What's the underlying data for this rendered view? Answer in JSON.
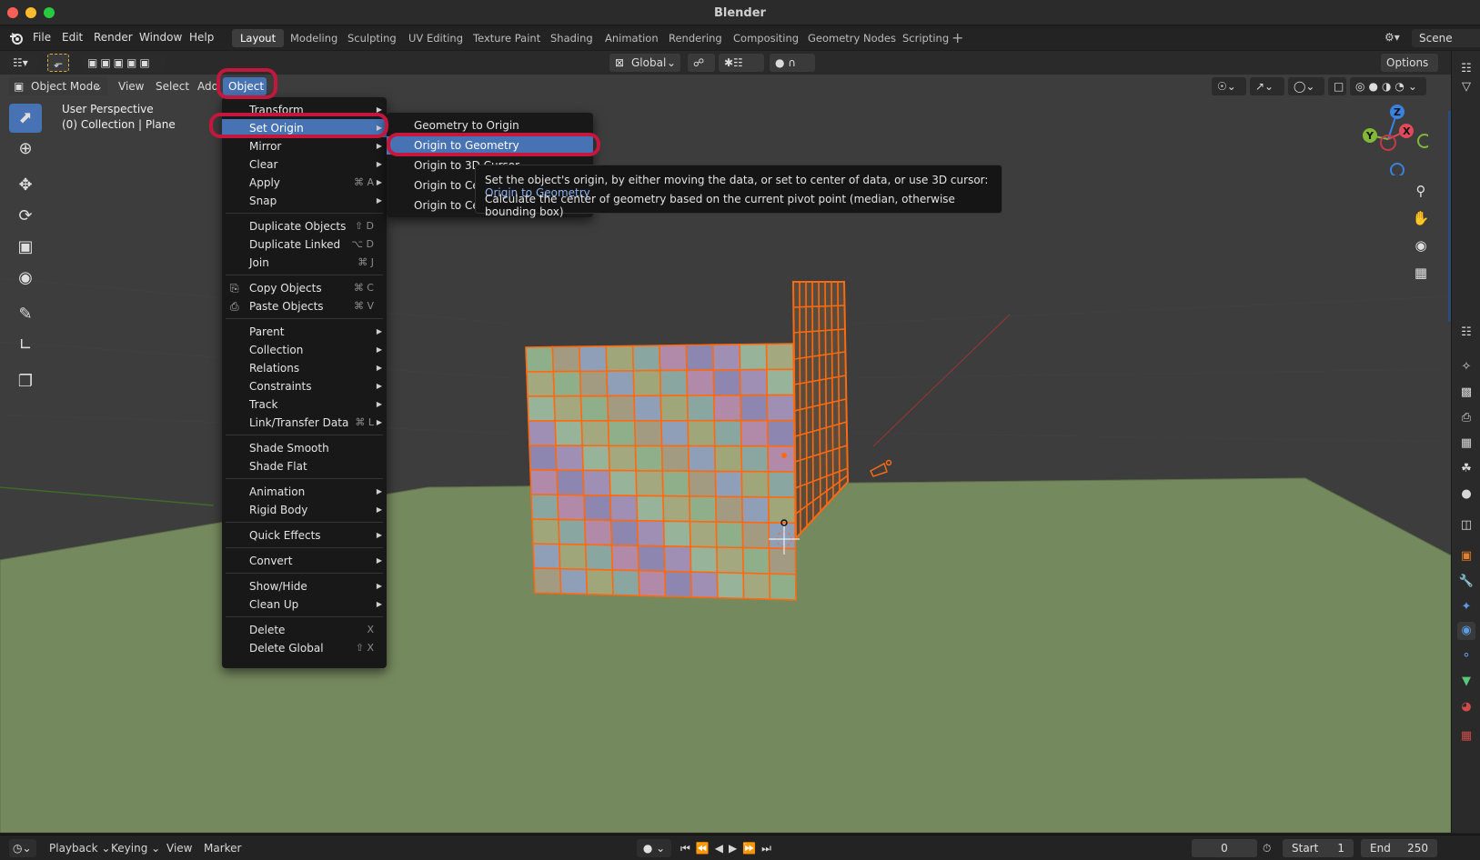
{
  "window": {
    "title": "Blender"
  },
  "menubar": {
    "items": [
      "File",
      "Edit",
      "Render",
      "Window",
      "Help"
    ],
    "workspaces": [
      "Layout",
      "Modeling",
      "Sculpting",
      "UV Editing",
      "Texture Paint",
      "Shading",
      "Animation",
      "Rendering",
      "Compositing",
      "Geometry Nodes",
      "Scripting"
    ],
    "active_workspace": "Layout",
    "scene": "Scene"
  },
  "header": {
    "transform_orientation": "Global",
    "options_label": "Options",
    "mode": "Object Mode",
    "menus": [
      "View",
      "Select",
      "Add",
      "Object"
    ]
  },
  "viewport": {
    "perspective_label": "User Perspective",
    "collection_label": "(0) Collection | Plane",
    "gizmo": {
      "z": "Z",
      "y": "Y",
      "x": "X"
    }
  },
  "object_menu": {
    "items": [
      {
        "label": "Transform",
        "shortcut": "",
        "submenu": true
      },
      {
        "label": "Set Origin",
        "shortcut": "",
        "submenu": true,
        "highlighted": true
      },
      {
        "label": "Mirror",
        "shortcut": "",
        "submenu": true
      },
      {
        "label": "Clear",
        "shortcut": "",
        "submenu": true
      },
      {
        "label": "Apply",
        "shortcut": "⌘ A",
        "submenu": true
      },
      {
        "label": "Snap",
        "shortcut": "",
        "submenu": true
      },
      {
        "label": "Duplicate Objects",
        "shortcut": "⇧ D",
        "submenu": false
      },
      {
        "label": "Duplicate Linked",
        "shortcut": "⌥ D",
        "submenu": false
      },
      {
        "label": "Join",
        "shortcut": "⌘ J",
        "submenu": false
      },
      {
        "label": "Copy Objects",
        "shortcut": "⌘ C",
        "submenu": false
      },
      {
        "label": "Paste Objects",
        "shortcut": "⌘ V",
        "submenu": false
      },
      {
        "label": "Parent",
        "shortcut": "",
        "submenu": true
      },
      {
        "label": "Collection",
        "shortcut": "",
        "submenu": true
      },
      {
        "label": "Relations",
        "shortcut": "",
        "submenu": true
      },
      {
        "label": "Constraints",
        "shortcut": "",
        "submenu": true
      },
      {
        "label": "Track",
        "shortcut": "",
        "submenu": true
      },
      {
        "label": "Link/Transfer Data",
        "shortcut": "⌘ L",
        "submenu": true
      },
      {
        "label": "Shade Smooth",
        "shortcut": "",
        "submenu": false
      },
      {
        "label": "Shade Flat",
        "shortcut": "",
        "submenu": false
      },
      {
        "label": "Animation",
        "shortcut": "",
        "submenu": true
      },
      {
        "label": "Rigid Body",
        "shortcut": "",
        "submenu": true
      },
      {
        "label": "Quick Effects",
        "shortcut": "",
        "submenu": true
      },
      {
        "label": "Convert",
        "shortcut": "",
        "submenu": true
      },
      {
        "label": "Show/Hide",
        "shortcut": "",
        "submenu": true
      },
      {
        "label": "Clean Up",
        "shortcut": "",
        "submenu": true
      },
      {
        "label": "Delete",
        "shortcut": "X",
        "submenu": false
      },
      {
        "label": "Delete Global",
        "shortcut": "⇧ X",
        "submenu": false
      }
    ]
  },
  "set_origin_menu": {
    "items": [
      {
        "label": "Geometry to Origin"
      },
      {
        "label": "Origin to Geometry",
        "highlighted": true
      },
      {
        "label": "Origin to 3D Cursor"
      },
      {
        "label": "Origin to Center of Mass (Surface)"
      },
      {
        "label": "Origin to Center of Mass (Volume)"
      }
    ]
  },
  "tooltip": {
    "line1": "Set the object's origin, by either moving the data, or set to center of data, or use 3D cursor:",
    "line1_op": "Origin to Geometry",
    "line2": "Calculate the center of geometry based on the current pivot point (median, otherwise bounding box)"
  },
  "timeline": {
    "menus": [
      "Playback",
      "Keying",
      "View",
      "Marker"
    ],
    "current_frame": "0",
    "start_label": "Start",
    "start_value": "1",
    "end_label": "End",
    "end_value": "250"
  },
  "colors": {
    "accent": "#4772b3",
    "highlight_ring": "#c4173e",
    "selection_orange": "#ff6a10",
    "ground": "#75895e"
  },
  "icons": [
    "blender-logo-icon",
    "select-box-icon",
    "cursor-icon",
    "move-icon",
    "rotate-icon",
    "scale-icon",
    "transform-icon",
    "annotate-icon",
    "measure-icon",
    "add-cube-icon",
    "zoom-icon",
    "hand-icon",
    "camera-icon",
    "grid-icon"
  ]
}
